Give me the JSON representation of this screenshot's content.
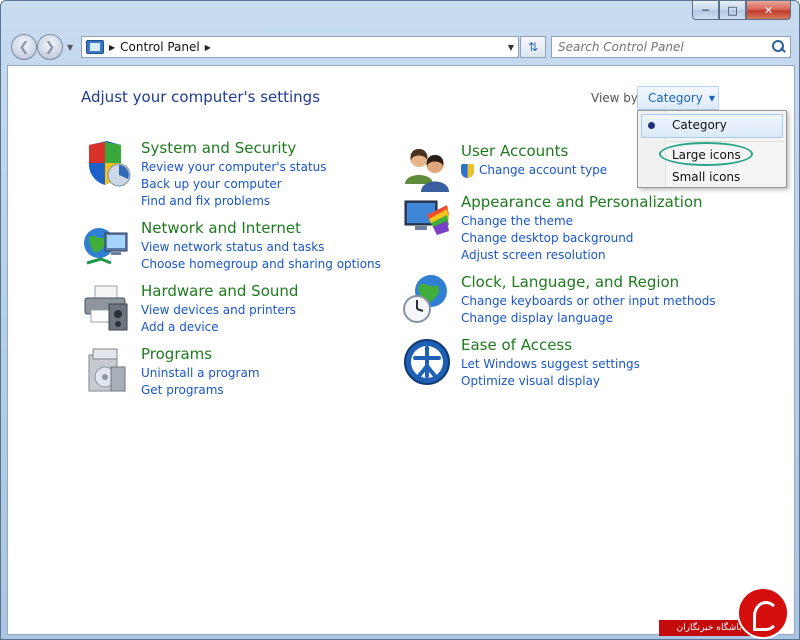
{
  "window": {
    "caption_buttons": [
      "minimize",
      "maximize",
      "close"
    ]
  },
  "navbar": {
    "breadcrumb": [
      "Control Panel"
    ],
    "search_placeholder": "Search Control Panel"
  },
  "header": {
    "title": "Adjust your computer's settings",
    "view_by_label": "View by:",
    "view_by_value": "Category"
  },
  "categories_left": [
    {
      "title": "System and Security",
      "icon": "shield-icon",
      "links": [
        "Review your computer's status",
        "Back up your computer",
        "Find and fix problems"
      ]
    },
    {
      "title": "Network and Internet",
      "icon": "network-globe-icon",
      "links": [
        "View network status and tasks",
        "Choose homegroup and sharing options"
      ]
    },
    {
      "title": "Hardware and Sound",
      "icon": "printer-icon",
      "links": [
        "View devices and printers",
        "Add a device"
      ]
    },
    {
      "title": "Programs",
      "icon": "programs-box-icon",
      "links": [
        "Uninstall a program",
        "Get programs"
      ]
    }
  ],
  "categories_right": [
    {
      "title": "User Accounts",
      "icon": "users-icon",
      "links": [
        "Change account type"
      ]
    },
    {
      "title": "Appearance and Personalization",
      "icon": "monitor-palette-icon",
      "links": [
        "Change the theme",
        "Change desktop background",
        "Adjust screen resolution"
      ]
    },
    {
      "title": "Clock, Language, and Region",
      "icon": "clock-globe-icon",
      "links": [
        "Change keyboards or other input methods",
        "Change display language"
      ]
    },
    {
      "title": "Ease of Access",
      "icon": "ease-of-access-icon",
      "links": [
        "Let Windows suggest settings",
        "Optimize visual display"
      ]
    }
  ],
  "view_menu": {
    "items": [
      "Category",
      "Large icons",
      "Small icons"
    ],
    "selected": "Category",
    "highlighted": "Large icons"
  },
  "watermark": {
    "text": "باشگاه خبرنگاران"
  },
  "colors": {
    "title_blue": "#1e3d8f",
    "category_green": "#1e7a1e",
    "link_blue": "#1a56c6",
    "highlight_ring": "#2aa58a"
  }
}
